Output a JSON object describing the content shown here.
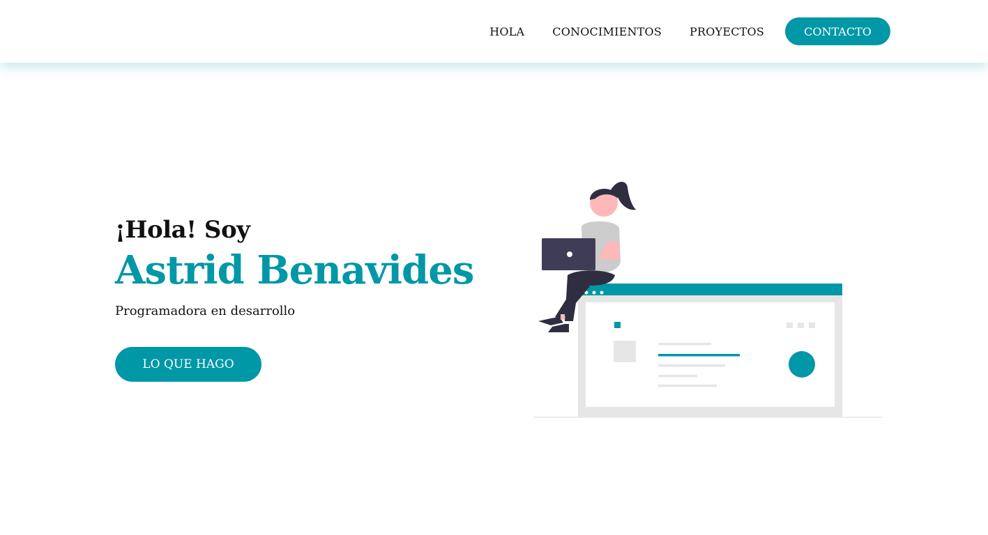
{
  "nav": {
    "items": [
      {
        "label": "HOLA"
      },
      {
        "label": "CONOCIMIENTOS"
      },
      {
        "label": "PROYECTOS"
      }
    ],
    "cta_label": "CONTACTO"
  },
  "hero": {
    "greeting": "¡Hola! Soy",
    "name": "Astrid Benavides",
    "subtitle": "Programadora en desarrollo",
    "button_label": "LO QUE HAGO"
  },
  "illustration": {
    "icon": "woman-working-on-laptop-illustration"
  },
  "colors": {
    "accent": "#0097a7",
    "text": "#111111",
    "background": "#ffffff",
    "illustration_gray": "#e6e6e6",
    "illustration_dark": "#2f2e41",
    "skin": "#ffb8b8"
  }
}
